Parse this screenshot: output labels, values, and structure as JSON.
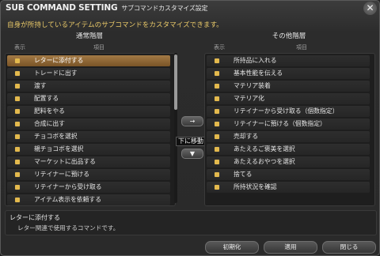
{
  "window": {
    "title": "SUB COMMAND SETTING",
    "subtitle": "サブコマンドカスタマイズ設定",
    "close_icon": "close-x-icon",
    "description": "自身が所持しているアイテムのサブコマンドをカスタマイズできます。"
  },
  "left_panel": {
    "title": "通常階層",
    "col_display": "表示",
    "col_item": "項目",
    "rows": [
      {
        "label": "レターに添付する",
        "selected": true
      },
      {
        "label": "トレードに出す"
      },
      {
        "label": "渡す"
      },
      {
        "label": "配置する"
      },
      {
        "label": "肥料をやる"
      },
      {
        "label": "合成に出す"
      },
      {
        "label": "チョコボを選択"
      },
      {
        "label": "親チョコボを選択"
      },
      {
        "label": "マーケットに出品する"
      },
      {
        "label": "リテイナーに預ける"
      },
      {
        "label": "リテイナーから受け取る"
      },
      {
        "label": "アイテム表示を依頼する"
      }
    ]
  },
  "right_panel": {
    "title": "その他階層",
    "col_display": "表示",
    "col_item": "項目",
    "rows": [
      {
        "label": "所持品に入れる"
      },
      {
        "label": "基本性能を伝える"
      },
      {
        "label": "マテリア装着"
      },
      {
        "label": "マテリア化"
      },
      {
        "label": "リテイナーから受け取る（個数指定）"
      },
      {
        "label": "リテイナーに預ける（個数指定）"
      },
      {
        "label": "売却する"
      },
      {
        "label": "あたえるご褒美を選択"
      },
      {
        "label": "あたえるおやつを選択"
      },
      {
        "label": "捨てる"
      },
      {
        "label": "所持状況を確認"
      }
    ]
  },
  "move_right": "→",
  "move_down": "▼",
  "tooltip": "下に移動",
  "help": {
    "title": "レターに添付する",
    "text": "レター関連で使用するコマンドです。"
  },
  "buttons": {
    "reset": "初期化",
    "apply": "適用",
    "close": "閉じる"
  },
  "colors": {
    "selected_row": "#8b6434",
    "check": "#e3b94d",
    "description_text": "#e8c868"
  }
}
